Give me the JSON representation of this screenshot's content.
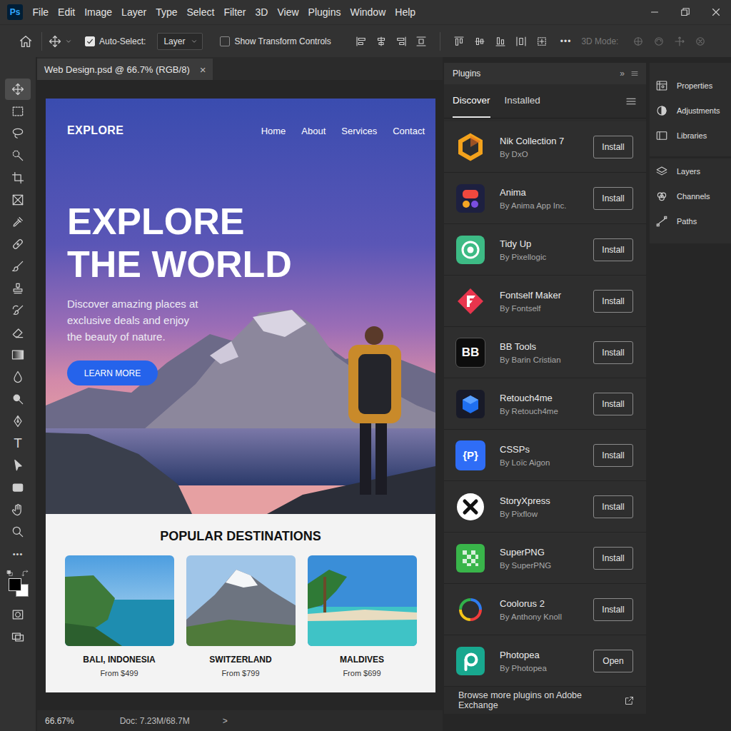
{
  "app": {
    "logo": "Ps"
  },
  "menu": [
    "File",
    "Edit",
    "Image",
    "Layer",
    "Type",
    "Select",
    "Filter",
    "3D",
    "View",
    "Plugins",
    "Window",
    "Help"
  ],
  "options_bar": {
    "auto_select": {
      "label": "Auto-Select:",
      "checked": true
    },
    "target": "Layer",
    "transform_controls": {
      "label": "Show Transform Controls",
      "checked": false
    },
    "more": "•••",
    "mode_label": "3D Mode:"
  },
  "tools": [
    {
      "kind": "move",
      "selected": true
    },
    {
      "kind": "marquee",
      "selected": false
    },
    {
      "kind": "lasso",
      "selected": false
    },
    {
      "kind": "quickselect",
      "selected": false
    },
    {
      "kind": "crop",
      "selected": false
    },
    {
      "kind": "frame",
      "selected": false
    },
    {
      "kind": "eyedropper",
      "selected": false
    },
    {
      "kind": "healing",
      "selected": false
    },
    {
      "kind": "brush",
      "selected": false
    },
    {
      "kind": "stamp",
      "selected": false
    },
    {
      "kind": "historybrush",
      "selected": false
    },
    {
      "kind": "eraser",
      "selected": false
    },
    {
      "kind": "gradient",
      "selected": false
    },
    {
      "kind": "blur",
      "selected": false
    },
    {
      "kind": "dodge",
      "selected": false
    },
    {
      "kind": "pen",
      "selected": false
    },
    {
      "kind": "type",
      "glyph": "T",
      "selected": false
    },
    {
      "kind": "pathselect",
      "selected": false
    },
    {
      "kind": "shape",
      "selected": false
    },
    {
      "kind": "hand",
      "selected": false
    },
    {
      "kind": "zoom",
      "selected": false
    },
    {
      "kind": "more",
      "glyph": "•••",
      "selected": false
    },
    {
      "kind": "colors",
      "foreground": "#000000",
      "background": "#ffffff",
      "selected": false
    },
    {
      "kind": "quickmask",
      "selected": false
    },
    {
      "kind": "screenmode",
      "selected": false
    }
  ],
  "document_tab": {
    "title": "Web Design.psd @ 66.7% (RGB/8)",
    "close": "×"
  },
  "design": {
    "brand": "EXPLORE",
    "nav": [
      "Home",
      "About",
      "Services",
      "Contact"
    ],
    "headline": [
      "EXPLORE",
      "THE WORLD"
    ],
    "intro": [
      "Discover amazing places at",
      "exclusive deals and enjoy",
      "the beauty of nature."
    ],
    "cta": "LEARN MORE",
    "section_title": "POPULAR DESTINATIONS",
    "destinations": [
      {
        "name": "BALI, INDONESIA",
        "price": "From $499",
        "kind": "island"
      },
      {
        "name": "SWITZERLAND",
        "price": "From $799",
        "kind": "mountain"
      },
      {
        "name": "MALDIVES",
        "price": "From $699",
        "kind": "beach"
      }
    ]
  },
  "status_bar": {
    "zoom": "66.67%",
    "doc": "Doc: 7.23M/68.7M",
    "arrow": ">"
  },
  "plugins_panel": {
    "title": "Plugins",
    "collapse": "»",
    "tabs": [
      {
        "label": "Discover",
        "selected": true
      },
      {
        "label": "Installed",
        "selected": false
      }
    ],
    "items": [
      {
        "name": "Nik Collection 7",
        "vendor": "By DxO",
        "action": "Install",
        "kind": "nik"
      },
      {
        "name": "Anima",
        "vendor": "By Anima App Inc.",
        "action": "Install",
        "kind": "anima"
      },
      {
        "name": "Tidy Up",
        "vendor": "By Pixellogic",
        "action": "Install",
        "kind": "tidy"
      },
      {
        "name": "Fontself Maker",
        "vendor": "By Fontself",
        "action": "Install",
        "kind": "fontself"
      },
      {
        "name": "BB Tools",
        "vendor": "By Barin Cristian",
        "action": "Install",
        "kind": "bb",
        "logo": "BB"
      },
      {
        "name": "Retouch4me",
        "vendor": "By Retouch4me",
        "action": "Install",
        "kind": "retouch"
      },
      {
        "name": "CSSPs",
        "vendor": "By Loïc Aigon",
        "action": "Install",
        "kind": "cssps",
        "logo": "{P}"
      },
      {
        "name": "StoryXpress",
        "vendor": "By Pixflow",
        "action": "Install",
        "kind": "storyx"
      },
      {
        "name": "SuperPNG",
        "vendor": "By SuperPNG",
        "action": "Install",
        "kind": "superpng"
      },
      {
        "name": "Coolorus 2",
        "vendor": "By Anthony Knoll",
        "action": "Install",
        "kind": "coolorus"
      },
      {
        "name": "Photopea",
        "vendor": "By Photopea",
        "action": "Open",
        "kind": "photopea"
      }
    ],
    "footer": "Browse more plugins on Adobe Exchange"
  },
  "dock": [
    [
      {
        "label": "Properties",
        "kind": "properties"
      },
      {
        "label": "Adjustments",
        "kind": "adjustments"
      },
      {
        "label": "Libraries",
        "kind": "libraries"
      }
    ],
    [
      {
        "label": "Layers",
        "kind": "layers"
      },
      {
        "label": "Channels",
        "kind": "channels"
      },
      {
        "label": "Paths",
        "kind": "paths"
      }
    ]
  ]
}
